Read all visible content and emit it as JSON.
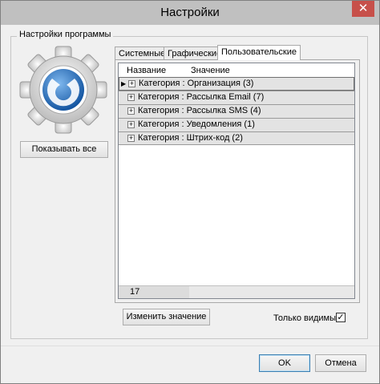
{
  "window": {
    "title": "Настройки",
    "close_glyph": "✕"
  },
  "group": {
    "label": "Настройки программы"
  },
  "buttons": {
    "show_all": "Показывать все",
    "change_value": "Изменить значение",
    "ok": "OK",
    "cancel": "Отмена"
  },
  "tabs": [
    {
      "label": "Системные",
      "active": false
    },
    {
      "label": "Графические",
      "active": false
    },
    {
      "label": "Пользовательские",
      "active": true
    }
  ],
  "grid": {
    "columns": [
      "Название",
      "Значение"
    ],
    "rows": [
      {
        "label": "Категория : Организация (3)",
        "selected": true
      },
      {
        "label": "Категория : Рассылка Email (7)",
        "selected": false
      },
      {
        "label": "Категория : Рассылка SMS (4)",
        "selected": false
      },
      {
        "label": "Категория : Уведомления (1)",
        "selected": false
      },
      {
        "label": "Категория : Штрих-код (2)",
        "selected": false
      }
    ],
    "footer_count": "17",
    "expander_glyph": "+",
    "pointer_glyph": "▶"
  },
  "only_visible": {
    "label": "Только видимые",
    "checked": true,
    "check_glyph": "✓"
  },
  "icons": {
    "settings_gear": "gear-icon"
  },
  "colors": {
    "accent_blue": "#1c6fbf",
    "close_red": "#c7504a"
  }
}
